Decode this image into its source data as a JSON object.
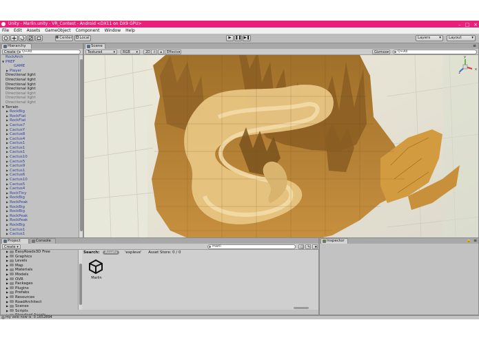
{
  "window": {
    "title": "Unity - Marlin.unity - VR_Contest - Android <DX11 on DX9 GPU>",
    "controls": [
      "–",
      "□",
      "×"
    ]
  },
  "menu": [
    "File",
    "Edit",
    "Assets",
    "GameObject",
    "Component",
    "Window",
    "Help"
  ],
  "toolbar": {
    "tools": [
      "hand-icon",
      "move-icon",
      "rotate-icon",
      "scale-icon",
      "rect-icon"
    ],
    "pivot_label": "Center",
    "space_label": "Local",
    "play_icons": [
      "▶",
      "❚❚",
      "▶❚"
    ],
    "layers_label": "Layers",
    "layout_label": "Layout"
  },
  "hierarchy": {
    "tab": "Hierarchy",
    "create_label": "Create",
    "search_placeholder": "Q+All",
    "items": [
      {
        "label": "RockArch",
        "indent": 0,
        "arrow": "",
        "color": "#2b3f9e"
      },
      {
        "label": "PREF",
        "indent": 0,
        "arrow": "▼",
        "color": "#2b3f9e"
      },
      {
        "label": "GAME",
        "indent": 2,
        "arrow": "",
        "color": "#2b3f9e"
      },
      {
        "label": "Player",
        "indent": 1,
        "arrow": "▶",
        "color": "#2b3f9e"
      },
      {
        "label": "Directional light",
        "indent": 0,
        "arrow": "",
        "color": "#111111"
      },
      {
        "label": "Directional light",
        "indent": 0,
        "arrow": "",
        "color": "#111111"
      },
      {
        "label": "Directional light",
        "indent": 0,
        "arrow": "",
        "color": "#111111"
      },
      {
        "label": "Directional light",
        "indent": 0,
        "arrow": "",
        "color": "#111111"
      },
      {
        "label": "Directional light",
        "indent": 0,
        "arrow": "",
        "color": "#6b6b6b"
      },
      {
        "label": "Directional light",
        "indent": 0,
        "arrow": "",
        "color": "#6b6b6b"
      },
      {
        "label": "Directional light",
        "indent": 0,
        "arrow": "",
        "color": "#6b6b6b"
      },
      {
        "label": "Terrain",
        "indent": 0,
        "arrow": "▼",
        "color": "#111111"
      },
      {
        "label": "RockBig",
        "indent": 1,
        "arrow": "▶",
        "color": "#2b3f9e"
      },
      {
        "label": "RockFlat",
        "indent": 1,
        "arrow": "▶",
        "color": "#2b3f9e"
      },
      {
        "label": "RockFlat",
        "indent": 1,
        "arrow": "▶",
        "color": "#2b3f9e"
      },
      {
        "label": "Cactus7",
        "indent": 1,
        "arrow": "▶",
        "color": "#2b3f9e"
      },
      {
        "label": "CactusY",
        "indent": 1,
        "arrow": "▶",
        "color": "#2b3f9e"
      },
      {
        "label": "Cactus8",
        "indent": 1,
        "arrow": "▶",
        "color": "#2b3f9e"
      },
      {
        "label": "Cactus4",
        "indent": 1,
        "arrow": "▶",
        "color": "#2b3f9e"
      },
      {
        "label": "Cactus1",
        "indent": 1,
        "arrow": "▶",
        "color": "#2b3f9e"
      },
      {
        "label": "Cactus1",
        "indent": 1,
        "arrow": "▶",
        "color": "#2b3f9e"
      },
      {
        "label": "Cactus1",
        "indent": 1,
        "arrow": "▶",
        "color": "#2b3f9e"
      },
      {
        "label": "Cactus10",
        "indent": 1,
        "arrow": "▶",
        "color": "#2b3f9e"
      },
      {
        "label": "Cactus5",
        "indent": 1,
        "arrow": "▶",
        "color": "#2b3f9e"
      },
      {
        "label": "Cactus9",
        "indent": 1,
        "arrow": "▶",
        "color": "#2b3f9e"
      },
      {
        "label": "Cactus1",
        "indent": 1,
        "arrow": "▶",
        "color": "#2b3f9e"
      },
      {
        "label": "Cactus6",
        "indent": 1,
        "arrow": "▶",
        "color": "#2b3f9e"
      },
      {
        "label": "Cactus10",
        "indent": 1,
        "arrow": "▶",
        "color": "#2b3f9e"
      },
      {
        "label": "Cactus5",
        "indent": 1,
        "arrow": "▶",
        "color": "#2b3f9e"
      },
      {
        "label": "Cactus4",
        "indent": 1,
        "arrow": "▶",
        "color": "#2b3f9e"
      },
      {
        "label": "RockTiny",
        "indent": 1,
        "arrow": "▶",
        "color": "#2b3f9e"
      },
      {
        "label": "RockBig",
        "indent": 1,
        "arrow": "▶",
        "color": "#2b3f9e"
      },
      {
        "label": "RockPeak",
        "indent": 1,
        "arrow": "▶",
        "color": "#2b3f9e"
      },
      {
        "label": "RockBig",
        "indent": 1,
        "arrow": "▶",
        "color": "#2b3f9e"
      },
      {
        "label": "RockBig",
        "indent": 1,
        "arrow": "▶",
        "color": "#2b3f9e"
      },
      {
        "label": "RockPeak",
        "indent": 1,
        "arrow": "▶",
        "color": "#2b3f9e"
      },
      {
        "label": "RockPeak",
        "indent": 1,
        "arrow": "▶",
        "color": "#2b3f9e"
      },
      {
        "label": "RockBig",
        "indent": 1,
        "arrow": "▶",
        "color": "#2b3f9e"
      },
      {
        "label": "Cactus1",
        "indent": 1,
        "arrow": "▶",
        "color": "#2b3f9e"
      },
      {
        "label": "Cactus1",
        "indent": 1,
        "arrow": "▶",
        "color": "#2b3f9e"
      }
    ]
  },
  "scene": {
    "tab": "Scene",
    "shading": "Textured",
    "render_mode": "RGB",
    "toggle_2d": "2D",
    "effects_label": "Effects",
    "gizmos_label": "Gizmos",
    "search_placeholder": "Q+All",
    "gizmo_axes": [
      "y",
      "x",
      "z"
    ]
  },
  "project": {
    "tabs": [
      "Project",
      "Console"
    ],
    "create_label": "Create",
    "search_value": "marli",
    "search_bar": {
      "label": "Search:",
      "assets_chip": "Assets",
      "scope": "'expleve'",
      "store_label": "Asset Store: 0 / 0"
    },
    "folders": [
      "EasyRoads3D Free",
      "Graphics",
      "Levels",
      "Map",
      "Materials",
      "Models",
      "OVR",
      "Packages",
      "Plugins",
      "Prefabs",
      "Resources",
      "RoadArchitect",
      "Scenes",
      "Scripts",
      "Standard Assets"
    ],
    "result_asset": "Marlin"
  },
  "inspector": {
    "tab": "Inspector"
  },
  "status": {
    "message": "my velo now is: 0.1652894"
  },
  "colors": {
    "title_bar": "#e8207a",
    "panel_bg": "#c2c2c2",
    "terrain": "#c8903a",
    "link_blue": "#2b3f9e"
  }
}
